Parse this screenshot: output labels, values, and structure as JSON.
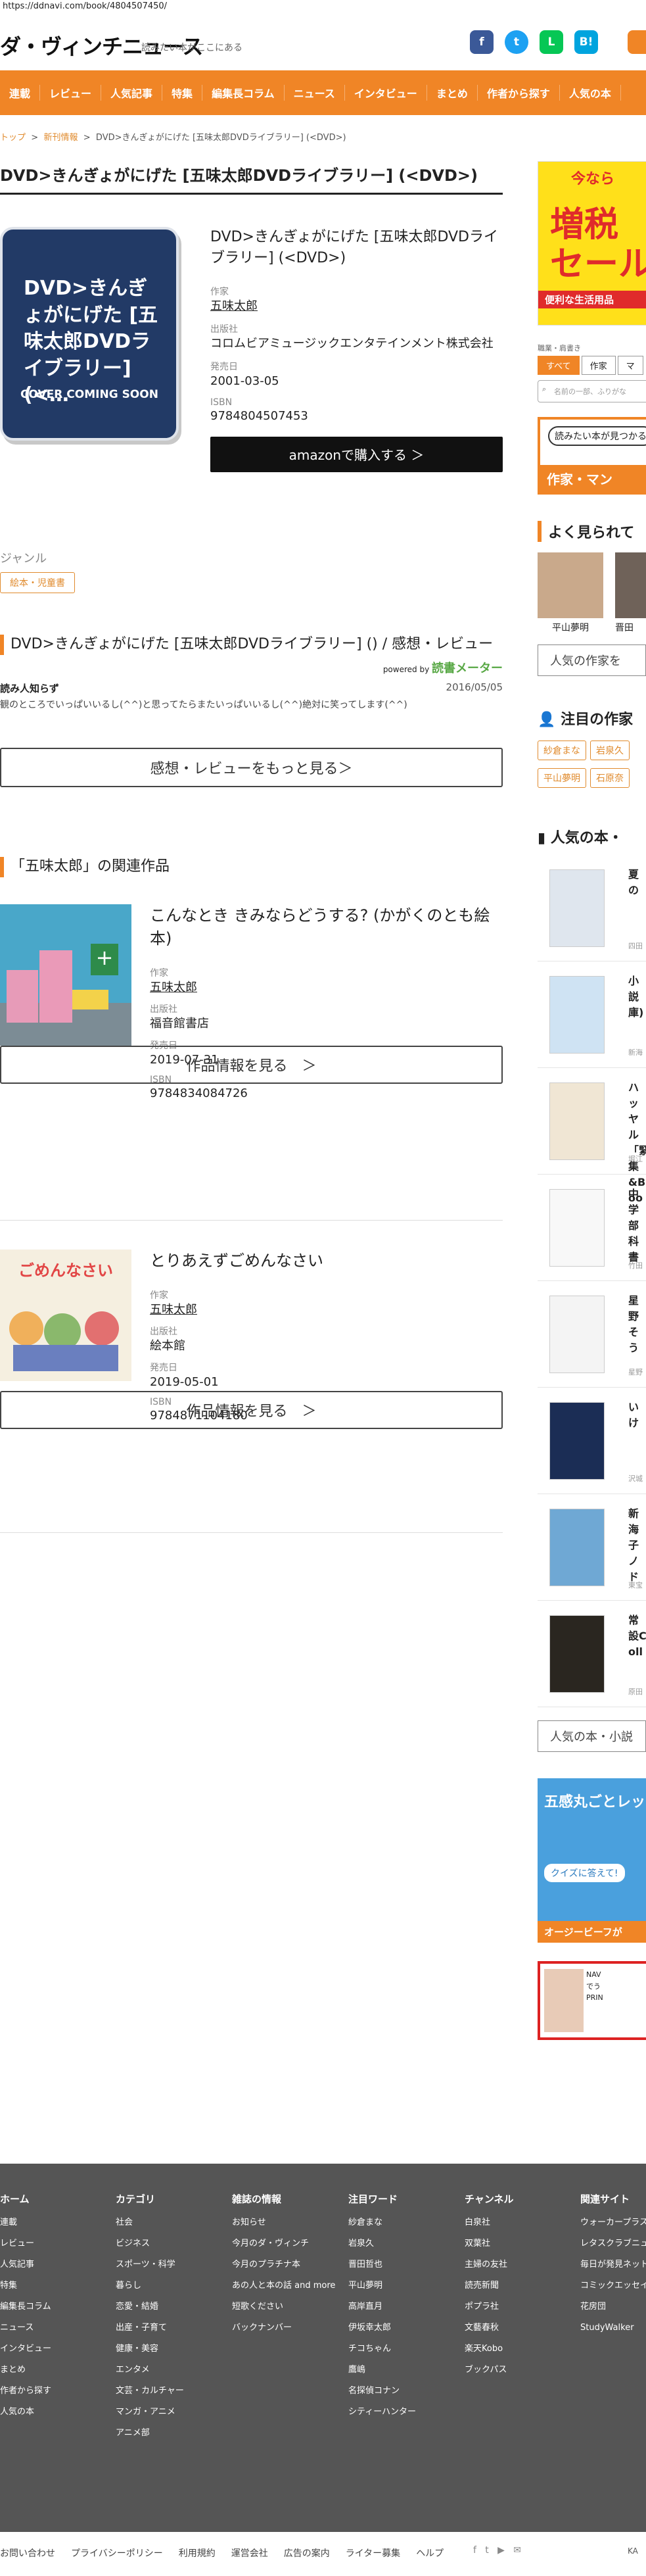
{
  "url": "https://ddnavi.com/book/4804507450/",
  "site": {
    "logo": "ダ・ヴィンチニュース",
    "tagline": "読みたい本がここにある"
  },
  "social": [
    {
      "name": "f",
      "color": "#3b5998"
    },
    {
      "name": "t",
      "color": "#1da1f2"
    },
    {
      "name": "L",
      "color": "#06c755"
    },
    {
      "name": "B!",
      "color": "#00a4de"
    }
  ],
  "nav": [
    "連載",
    "レビュー",
    "人気記事",
    "特集",
    "編集長コラム",
    "ニュース",
    "インタビュー",
    "まとめ",
    "作者から探す",
    "人気の本"
  ],
  "breadcrumb": {
    "top": "トップ",
    "sep": ">",
    "news": "新刊情報",
    "current": "DVD>きんぎょがにげた [五味太郎DVDライブラリー] (<DVD>)"
  },
  "book": {
    "title": "DVD>きんぎょがにげた [五味太郎DVDライブラリー] (<DVD>)",
    "cover_title": "DVD>きんぎょがにげた [五味太郎DVDライブラリー] (<…",
    "cover_soon": "COVER COMING SOON",
    "author_label": "作家",
    "author": "五味太郎",
    "publisher_label": "出版社",
    "publisher": "コロムビアミュージックエンタテインメント株式会社",
    "date_label": "発売日",
    "date": "2001-03-05",
    "isbn_label": "ISBN",
    "isbn": "9784804507453",
    "amazon": "amazonで購入する ＞"
  },
  "genre": {
    "label": "ジャンル",
    "tag": "絵本・児童書"
  },
  "review": {
    "heading": "DVD>きんぎょがにげた [五味太郎DVDライブラリー] () / 感想・レビュー",
    "powered": "powered by",
    "meter": "読書メーター",
    "user": "読み人知らず",
    "date": "2016/05/05",
    "text": "観のところでいっぱいいるし(^^)と思ってたらまたいっぱいいるし(^^)絶対に笑ってします(^^)",
    "more": "感想・レビューをもっと見る＞"
  },
  "related": {
    "heading": "「五味太郎」の関連作品",
    "items": [
      {
        "title": "こんなとき きみならどうする? (かがくのとも絵本)",
        "author_label": "作家",
        "author": "五味太郎",
        "publisher_label": "出版社",
        "publisher": "福音館書店",
        "date_label": "発売日",
        "date": "2019-07-31",
        "isbn_label": "ISBN",
        "isbn": "9784834084726",
        "btn": "作品情報を見る　＞"
      },
      {
        "title": "とりあえずごめんなさい",
        "author_label": "作家",
        "author": "五味太郎",
        "publisher_label": "出版社",
        "publisher": "絵本館",
        "date_label": "発売日",
        "date": "2019-05-01",
        "isbn_label": "ISBN",
        "isbn": "9784871104180",
        "btn": "作品情報を見る　＞"
      }
    ]
  },
  "side": {
    "banner_top": "今なら",
    "banner_main1": "増税",
    "banner_main2": "セール",
    "banner_sub": "便利な生活用品",
    "search_label": "職業・肩書き",
    "tabs": [
      "すべて",
      "作家",
      "マ"
    ],
    "search_placeholder": "名前の一部、ふりがな",
    "promo": "作家・マン",
    "promo_small": "読みたい本が見つかる",
    "popular_h": "よく見られて",
    "authors": [
      "平山夢明",
      "晋田"
    ],
    "popular_btn": "人気の作家を",
    "attention_h": "注目の作家",
    "attention_tags": [
      "紗倉まな",
      "岩泉久",
      "平山夢明",
      "石原奈"
    ],
    "books_h": "人気の本・",
    "books": [
      {
        "t": "夏の",
        "s": "四田"
      },
      {
        "t": "小説庫)",
        "s": "新海"
      },
      {
        "t": "ハッヤル「緊集&Boo",
        "s": "堀江"
      },
      {
        "t": "中学部科書",
        "s": "竹田"
      },
      {
        "t": "星野そう",
        "s": "星野"
      },
      {
        "t": "いけ",
        "s": "沢城"
      },
      {
        "t": "新海子ノド",
        "s": "東宝"
      },
      {
        "t": "常設Coll",
        "s": "原田"
      }
    ],
    "books_btn": "人気の本・小説",
    "banner2": "五感丸ごとレッツ",
    "banner2_sub": "クイズに答えて!",
    "banner2_foot": "オージービーフが",
    "banner3": "NAV\nでう\nPRIN"
  },
  "footer": {
    "cols": [
      {
        "h": "ホーム",
        "items": [
          "連載",
          "レビュー",
          "人気記事",
          "特集",
          "編集長コラム",
          "ニュース",
          "インタビュー",
          "まとめ",
          "作者から探す",
          "人気の本"
        ]
      },
      {
        "h": "カテゴリ",
        "items": [
          "社会",
          "ビジネス",
          "スポーツ・科学",
          "暮らし",
          "恋愛・結婚",
          "出産・子育て",
          "健康・美容",
          "エンタメ",
          "文芸・カルチャー",
          "マンガ・アニメ",
          "アニメ部"
        ]
      },
      {
        "h": "雑誌の情報",
        "items": [
          "お知らせ",
          "今月のダ・ヴィンチ",
          "今月のプラチナ本",
          "あの人と本の話 and more",
          "短歌ください",
          "バックナンバー"
        ]
      },
      {
        "h": "注目ワード",
        "items": [
          "紗倉まな",
          "岩泉久",
          "晋田哲也",
          "平山夢明",
          "高岸直月",
          "伊坂幸太郎",
          "チコちゃん",
          "鷹嶋",
          "名探偵コナン",
          "シティーハンター"
        ]
      },
      {
        "h": "チャンネル",
        "items": [
          "白泉社",
          "双葉社",
          "主婦の友社",
          "読売新聞",
          "ポプラ社",
          "文藝春秋",
          "楽天Kobo",
          "ブックパス"
        ]
      },
      {
        "h": "関連サイト",
        "items": [
          "ウォーカープラス",
          "レタスクラブニュース",
          "毎日が発見ネット",
          "コミックエッセイ",
          "花房団",
          "StudyWalker"
        ]
      }
    ],
    "bottom": [
      "お問い合わせ",
      "プライバシーポリシー",
      "利用規約",
      "運営会社",
      "広告の案内",
      "ライター募集",
      "ヘルプ"
    ],
    "bottom_right": "KA"
  }
}
